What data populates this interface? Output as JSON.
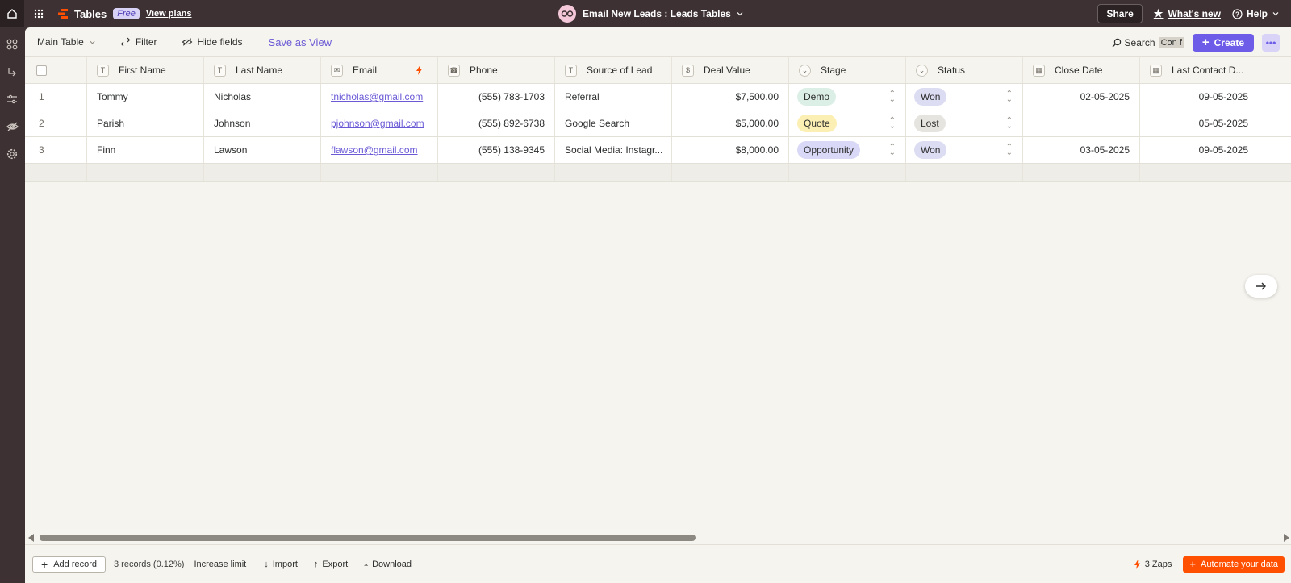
{
  "app": {
    "name": "Tables",
    "plan_badge": "Free",
    "view_plans": "View plans"
  },
  "document": {
    "title": "Email New Leads : Leads Tables"
  },
  "topbar": {
    "share": "Share",
    "whats_new": "What's new",
    "help": "Help"
  },
  "toolbar": {
    "view_select": "Main Table",
    "filter": "Filter",
    "hide_fields": "Hide fields",
    "save_as_view": "Save as View",
    "search_label": "Search",
    "search_value": "Con f",
    "create": "Create"
  },
  "columns": [
    {
      "label": "First Name",
      "icon": "text-field-icon",
      "glyph": "T"
    },
    {
      "label": "Last Name",
      "icon": "text-field-icon",
      "glyph": "T"
    },
    {
      "label": "Email",
      "icon": "email-field-icon",
      "glyph": "✉"
    },
    {
      "label": "Phone",
      "icon": "phone-field-icon",
      "glyph": "☎"
    },
    {
      "label": "Source of Lead",
      "icon": "text-field-icon",
      "glyph": "T"
    },
    {
      "label": "Deal Value",
      "icon": "currency-field-icon",
      "glyph": "$"
    },
    {
      "label": "Stage",
      "icon": "dropdown-field-icon",
      "glyph": "⌄"
    },
    {
      "label": "Status",
      "icon": "dropdown-field-icon",
      "glyph": "⌄"
    },
    {
      "label": "Close Date",
      "icon": "date-field-icon",
      "glyph": "▦"
    },
    {
      "label": "Last Contact D...",
      "icon": "date-field-icon",
      "glyph": "▦"
    }
  ],
  "rows": [
    {
      "num": "1",
      "first": "Tommy",
      "last": "Nicholas",
      "email": "tnicholas@gmail.com",
      "phone": "(555) 783-1703",
      "source": "Referral",
      "deal": "$7,500.00",
      "stage": "Demo",
      "status": "Won",
      "close": "02-05-2025",
      "last_contact": "09-05-2025"
    },
    {
      "num": "2",
      "first": "Parish",
      "last": "Johnson",
      "email": "pjohnson@gmail.com",
      "phone": "(555) 892-6738",
      "source": "Google Search",
      "deal": "$5,000.00",
      "stage": "Quote",
      "status": "Lost",
      "close": "",
      "last_contact": "05-05-2025"
    },
    {
      "num": "3",
      "first": "Finn",
      "last": "Lawson",
      "email": "flawson@gmail.com",
      "phone": "(555) 138-9345",
      "source": "Social Media: Instagr...",
      "deal": "$8,000.00",
      "stage": "Opportunity",
      "status": "Won",
      "close": "03-05-2025",
      "last_contact": "09-05-2025"
    }
  ],
  "pill_colors": {
    "Demo": "#dcefe6",
    "Quote": "#fcefb4",
    "Opportunity": "#d9d8f6",
    "Won": "#dcdcf3",
    "Lost": "#e6e4df"
  },
  "footer": {
    "add_record": "Add record",
    "records": "3 records (0.12%)",
    "increase_limit": "Increase limit",
    "import": "Import",
    "export": "Export",
    "download": "Download",
    "zaps": "3 Zaps",
    "automate": "Automate your data"
  },
  "colors": {
    "accent": "#6c5ce7",
    "zapier_orange": "#ff4f00",
    "chrome": "#3d3133"
  }
}
